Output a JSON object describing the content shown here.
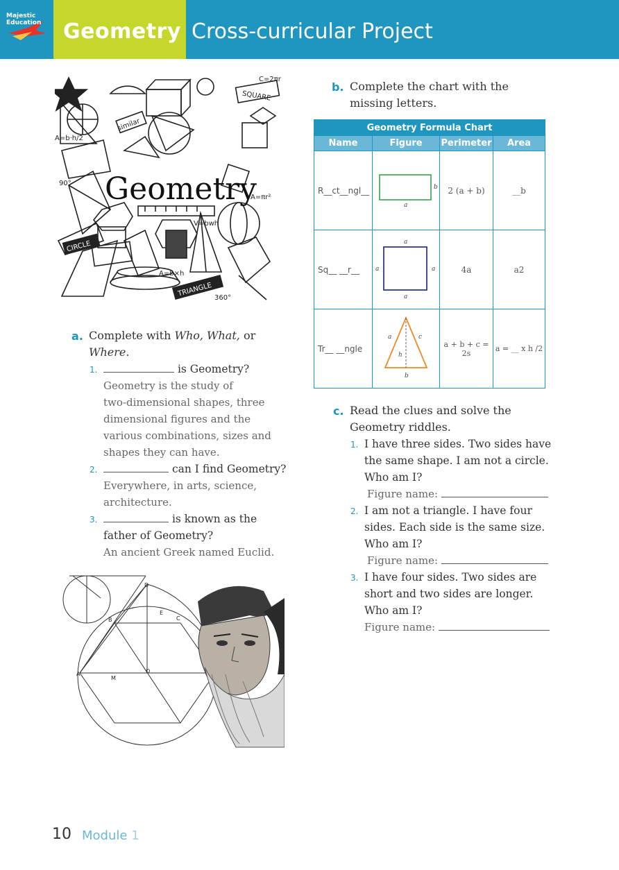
{
  "header": {
    "logo": "Majestic Education",
    "title_main": "Geometry",
    "title_sub": "Cross-curricular Project"
  },
  "section_a": {
    "letter": "a.",
    "prompt_1": "Complete with ",
    "prompt_italic": "Who, What,",
    "prompt_2": " or",
    "prompt_italic2": "Where",
    "prompt_end": ".",
    "items": [
      {
        "num": "1.",
        "tail": "is Geometry?",
        "answer_lines": [
          "Geometry is the study of",
          "two-dimensional shapes, three",
          "dimensional figures and the",
          "various combinations, sizes and",
          "shapes they can have."
        ]
      },
      {
        "num": "2.",
        "tail": "can I find Geometry?",
        "answer_lines": [
          "Everywhere, in arts, science,",
          "architecture."
        ]
      },
      {
        "num": "3.",
        "tail": "is known as the",
        "tail2": "father of Geometry?",
        "answer_lines": [
          "An ancient Greek named Euclid."
        ]
      }
    ]
  },
  "doodle": {
    "word": "Geometry",
    "labels": [
      "SQUARE",
      "similar",
      "CIRCLE",
      "TRIANGLE",
      "C=2πr",
      "A=b·h/2",
      "A=πr²",
      "A=b×h",
      "360°",
      "90°",
      "V=bwh"
    ]
  },
  "euclid_labels": [
    "D",
    "B",
    "E",
    "C",
    "A",
    "M",
    "O"
  ],
  "section_b": {
    "letter": "b.",
    "prompt_lines": [
      "Complete the chart with the",
      "missing letters."
    ],
    "chart_title": "Geometry Formula Chart",
    "columns": [
      "Name",
      "Figure",
      "Perimeter",
      "Area"
    ],
    "rows": [
      {
        "name": "R__ct__ngl__",
        "perimeter": "2 (a + b)",
        "area": "__b",
        "fig_labels": [
          "b",
          "a"
        ]
      },
      {
        "name": "Sq__ __r__",
        "perimeter": "4a",
        "area": "a2",
        "fig_labels": [
          "a",
          "a",
          "a",
          "a"
        ]
      },
      {
        "name": "Tr__ __ngle",
        "perimeter": "a + b + c = 2s",
        "area": "a = __ x h /2",
        "fig_labels": [
          "a",
          "c",
          "h",
          "b"
        ]
      }
    ],
    "colors": {
      "rectangle": "#3aa04a",
      "square": "#2b3b8e",
      "triangle": "#f08a24"
    }
  },
  "section_c": {
    "letter": "c.",
    "prompt_lines": [
      "Read the clues and solve the",
      "Geometry riddles."
    ],
    "items": [
      {
        "num": "1.",
        "lines": [
          "I have three sides. Two sides have",
          "the same shape. I am not a circle.",
          "Who am I?"
        ],
        "fig_label": "Figure name:"
      },
      {
        "num": "2.",
        "lines": [
          "I am not a triangle. I have four",
          "sides. Each side is the same size.",
          "Who am I?"
        ],
        "fig_label": "Figure name:"
      },
      {
        "num": "3.",
        "lines": [
          "I have four sides. Two sides are",
          "short and two sides are longer.",
          "Who am I?"
        ],
        "fig_label": "Figure name:"
      }
    ]
  },
  "footer": {
    "page": "10",
    "module_label": "Module",
    "module_num": "1"
  },
  "colors": {
    "header_blue": "#1e96c0",
    "title_green": "#c6d72b",
    "accent": "#1e96c0"
  }
}
